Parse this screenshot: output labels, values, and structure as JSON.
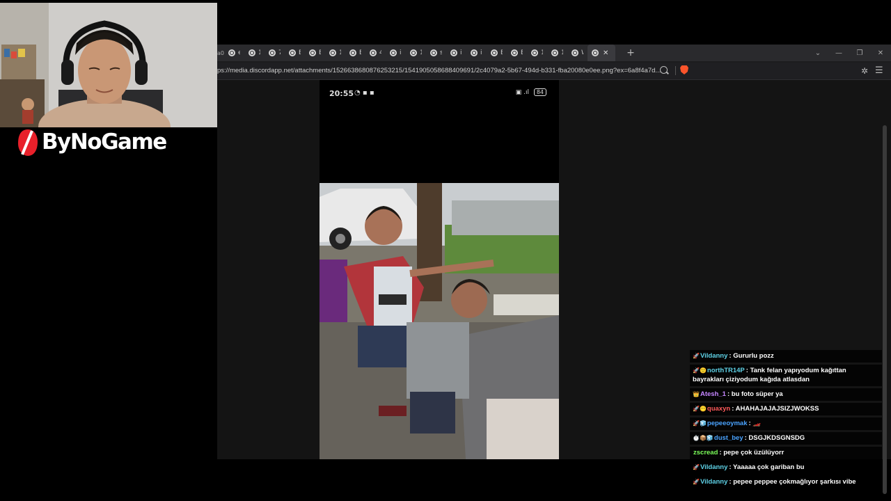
{
  "browser": {
    "tabs": [
      {
        "label": "ef"
      },
      {
        "label": "10"
      },
      {
        "label": "75"
      },
      {
        "label": "Ek"
      },
      {
        "label": "Ek"
      },
      {
        "label": "10"
      },
      {
        "label": "Ek"
      },
      {
        "label": "40"
      },
      {
        "label": "im"
      },
      {
        "label": "10"
      },
      {
        "label": "sa"
      },
      {
        "label": "im"
      },
      {
        "label": "im"
      },
      {
        "label": "Ek"
      },
      {
        "label": "Ek"
      },
      {
        "label": "10"
      },
      {
        "label": "14"
      },
      {
        "label": "W"
      }
    ],
    "first_tab_fragment": "a0",
    "url": "ps://media.discordapp.net/attachments/1526638680876253215/1541905058688409691/2c4079a2-5b67-494d-b331-fba20080e0ee.png?ex=6a8f4a7d..."
  },
  "phone_status": {
    "time": "20:55",
    "battery": "84"
  },
  "logo": {
    "text": "ByNoGame"
  },
  "chat": {
    "messages": [
      {
        "user": "Vildanny",
        "color": "#5fd3e8",
        "badges": "🚀",
        "text": "Gururlu pozz"
      },
      {
        "user": "northTR14P",
        "color": "#5fd3e8",
        "badges": "🚀🙂",
        "text": "Tank felan yapıyodum kağıttan bayrakları çiziyodum kağıda atlasdan"
      },
      {
        "user": "Atesh_1",
        "color": "#c586ff",
        "badges": "👑",
        "text": "bu foto süper ya"
      },
      {
        "user": "quaxyn",
        "color": "#ff5a5a",
        "badges": "🚀😶",
        "text": "AHAHAJAJAJSIZJWOKSS"
      },
      {
        "user": "pepeeoymak",
        "color": "#4aa3ff",
        "badges": "🚀🧊",
        "text": "🏎️"
      },
      {
        "user": "dust_bey",
        "color": "#4aa3ff",
        "badges": "⏱️📦🧊",
        "text": "DSGJKDSGNSDG"
      },
      {
        "user": "zscread",
        "color": "#7cff5a",
        "badges": "",
        "text": "pepe çok üzülüyorr"
      },
      {
        "user": "Vildanny",
        "color": "#5fd3e8",
        "badges": "🚀",
        "text": "Yaaaaa çok gariban bu"
      },
      {
        "user": "Vildanny",
        "color": "#5fd3e8",
        "badges": "🚀",
        "text": "pepee peppee çokmağlıyor şarkısı vibe"
      }
    ]
  }
}
